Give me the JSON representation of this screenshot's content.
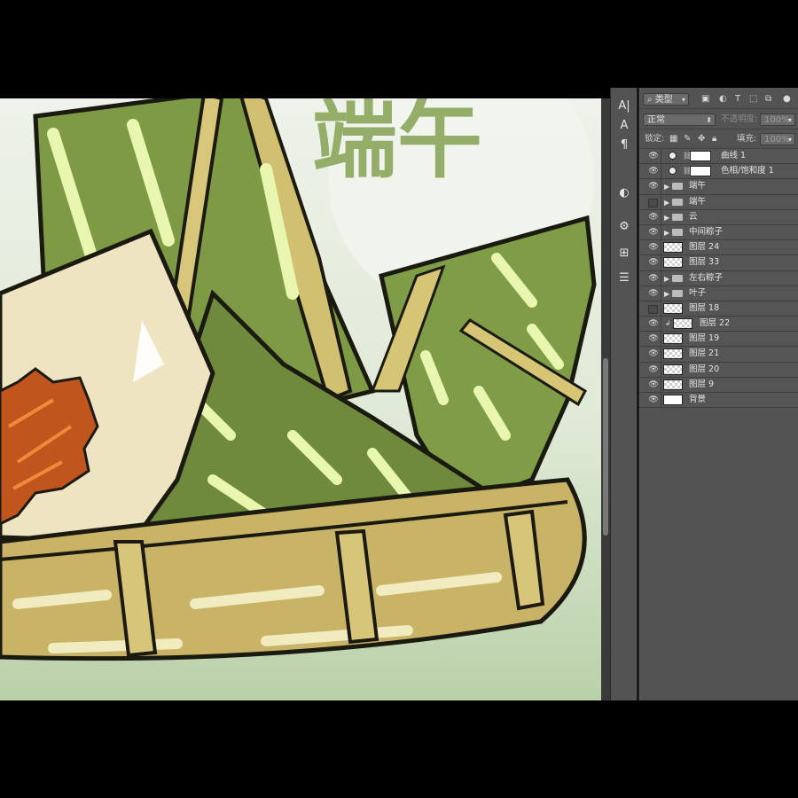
{
  "canvas": {
    "title_fragment": "端午",
    "colors": {
      "leaf_dark": "#6f8a3c",
      "leaf_mid": "#8aa24e",
      "leaf_highlight": "#e9f6b0",
      "rice": "#efe4c2",
      "filling": "#c0561e",
      "basket": "#c9b367",
      "basket_light": "#f1ecbf",
      "background": "#d8e6d0",
      "outline": "#1a1a10"
    }
  },
  "toolbar": {
    "filter_label": "类型",
    "blend_mode": "正常",
    "opacity_label": "不透明度:",
    "opacity_value": "100%",
    "lock_label": "锁定:",
    "fill_label": "填充:",
    "fill_value": "100%"
  },
  "tools": [
    {
      "icon": "A|"
    },
    {
      "icon": "A"
    },
    {
      "icon": "¶"
    },
    {
      "icon": "◐"
    },
    {
      "icon": "⚙"
    },
    {
      "icon": "⊞"
    },
    {
      "icon": "☰"
    }
  ],
  "layers": [
    {
      "name": "曲线 1",
      "kind": "adjustment",
      "visible": true
    },
    {
      "name": "色相/饱和度 1",
      "kind": "adjustment",
      "visible": true
    },
    {
      "name": "端午",
      "kind": "group",
      "visible": true
    },
    {
      "name": "端午",
      "kind": "group",
      "visible": false
    },
    {
      "name": "云",
      "kind": "group",
      "visible": true
    },
    {
      "name": "中间粽子",
      "kind": "group",
      "visible": true
    },
    {
      "name": "图层 24",
      "kind": "layer",
      "visible": true
    },
    {
      "name": "图层 33",
      "kind": "layer",
      "visible": true
    },
    {
      "name": "左右粽子",
      "kind": "group",
      "visible": true
    },
    {
      "name": "叶子",
      "kind": "group",
      "visible": true
    },
    {
      "name": "图层 18",
      "kind": "layer",
      "visible": false
    },
    {
      "name": "图层 22",
      "kind": "clipped",
      "visible": true
    },
    {
      "name": "图层 19",
      "kind": "layer",
      "visible": true
    },
    {
      "name": "图层 21",
      "kind": "layer",
      "visible": true
    },
    {
      "name": "图层 20",
      "kind": "layer",
      "visible": true
    },
    {
      "name": "图层 9",
      "kind": "layer",
      "visible": true
    },
    {
      "name": "背景",
      "kind": "background",
      "visible": true
    }
  ]
}
